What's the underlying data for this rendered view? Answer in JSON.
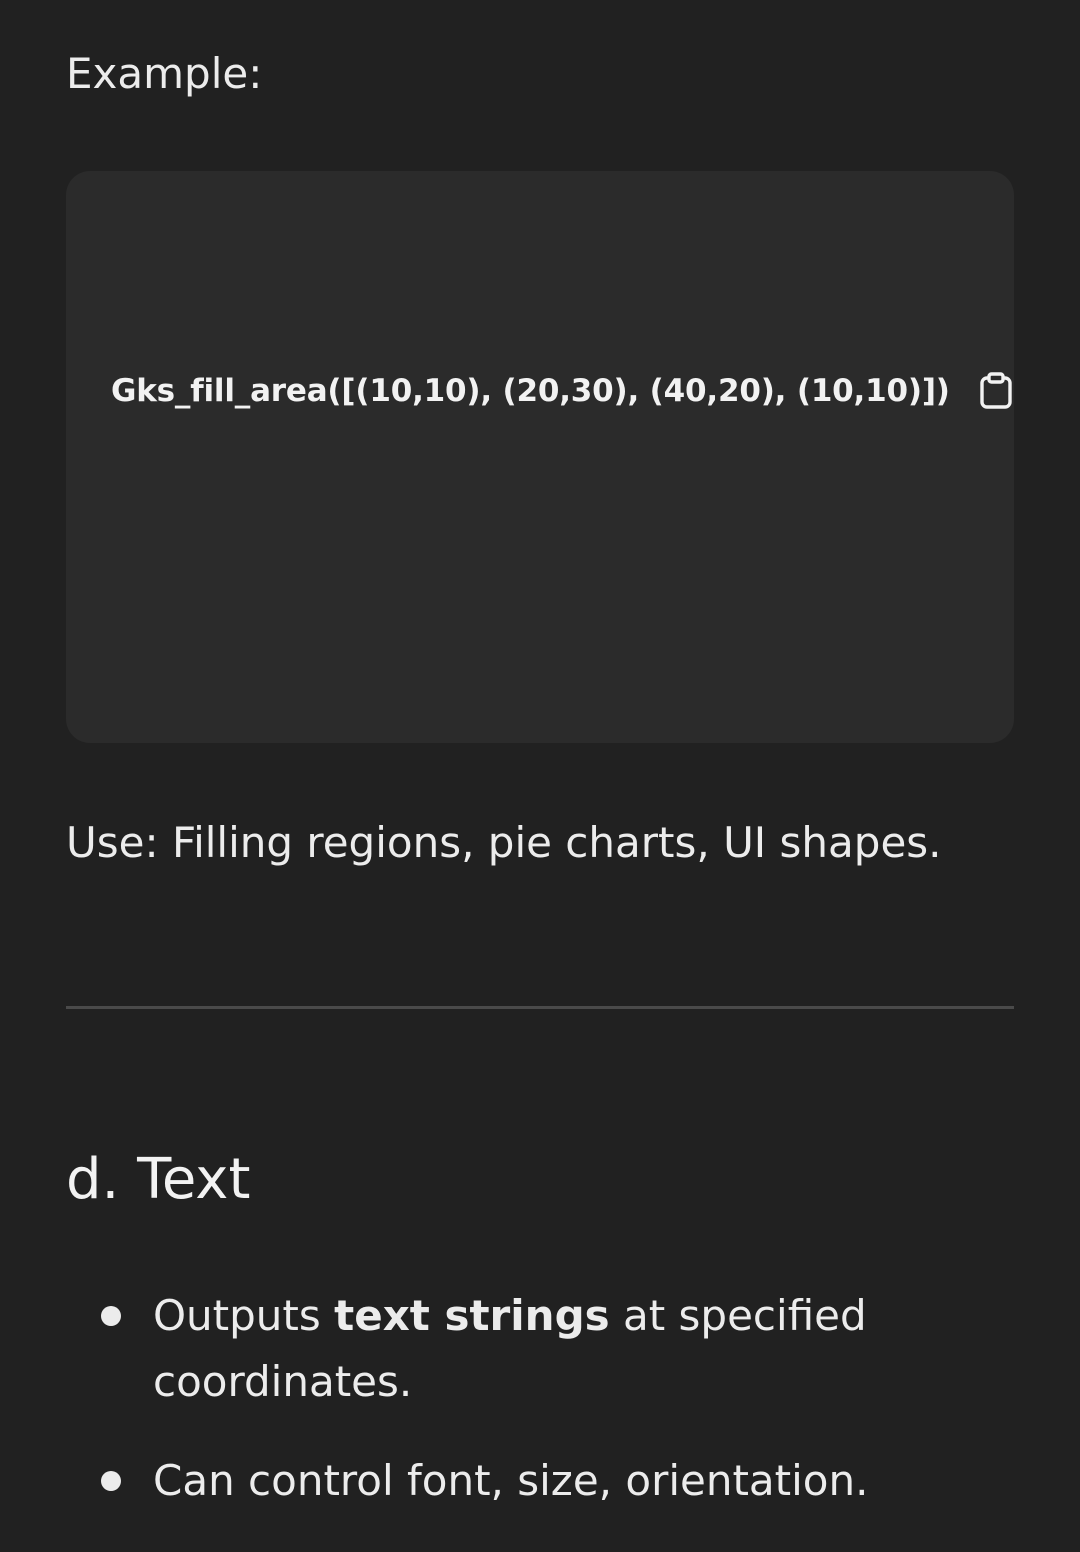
{
  "example": {
    "label": "Example:"
  },
  "code_block": {
    "code": "Gks_fill_area([(10,10), (20,30), (40,20), (10,10)])",
    "copy_icon": "clipboard-icon"
  },
  "use_line": {
    "text": "Use: Filling regions, pie charts, UI shapes."
  },
  "section": {
    "heading": "d. Text",
    "bullets": [
      {
        "before": "Outputs ",
        "bold": "text strings",
        "after": " at specified coordinates."
      },
      {
        "before": "Can control font, size, orientation.",
        "bold": "",
        "after": ""
      }
    ]
  },
  "colors": {
    "background": "#212121",
    "code_background": "#2b2b2b",
    "text": "#ececec",
    "divider": "#4a4a4a"
  }
}
